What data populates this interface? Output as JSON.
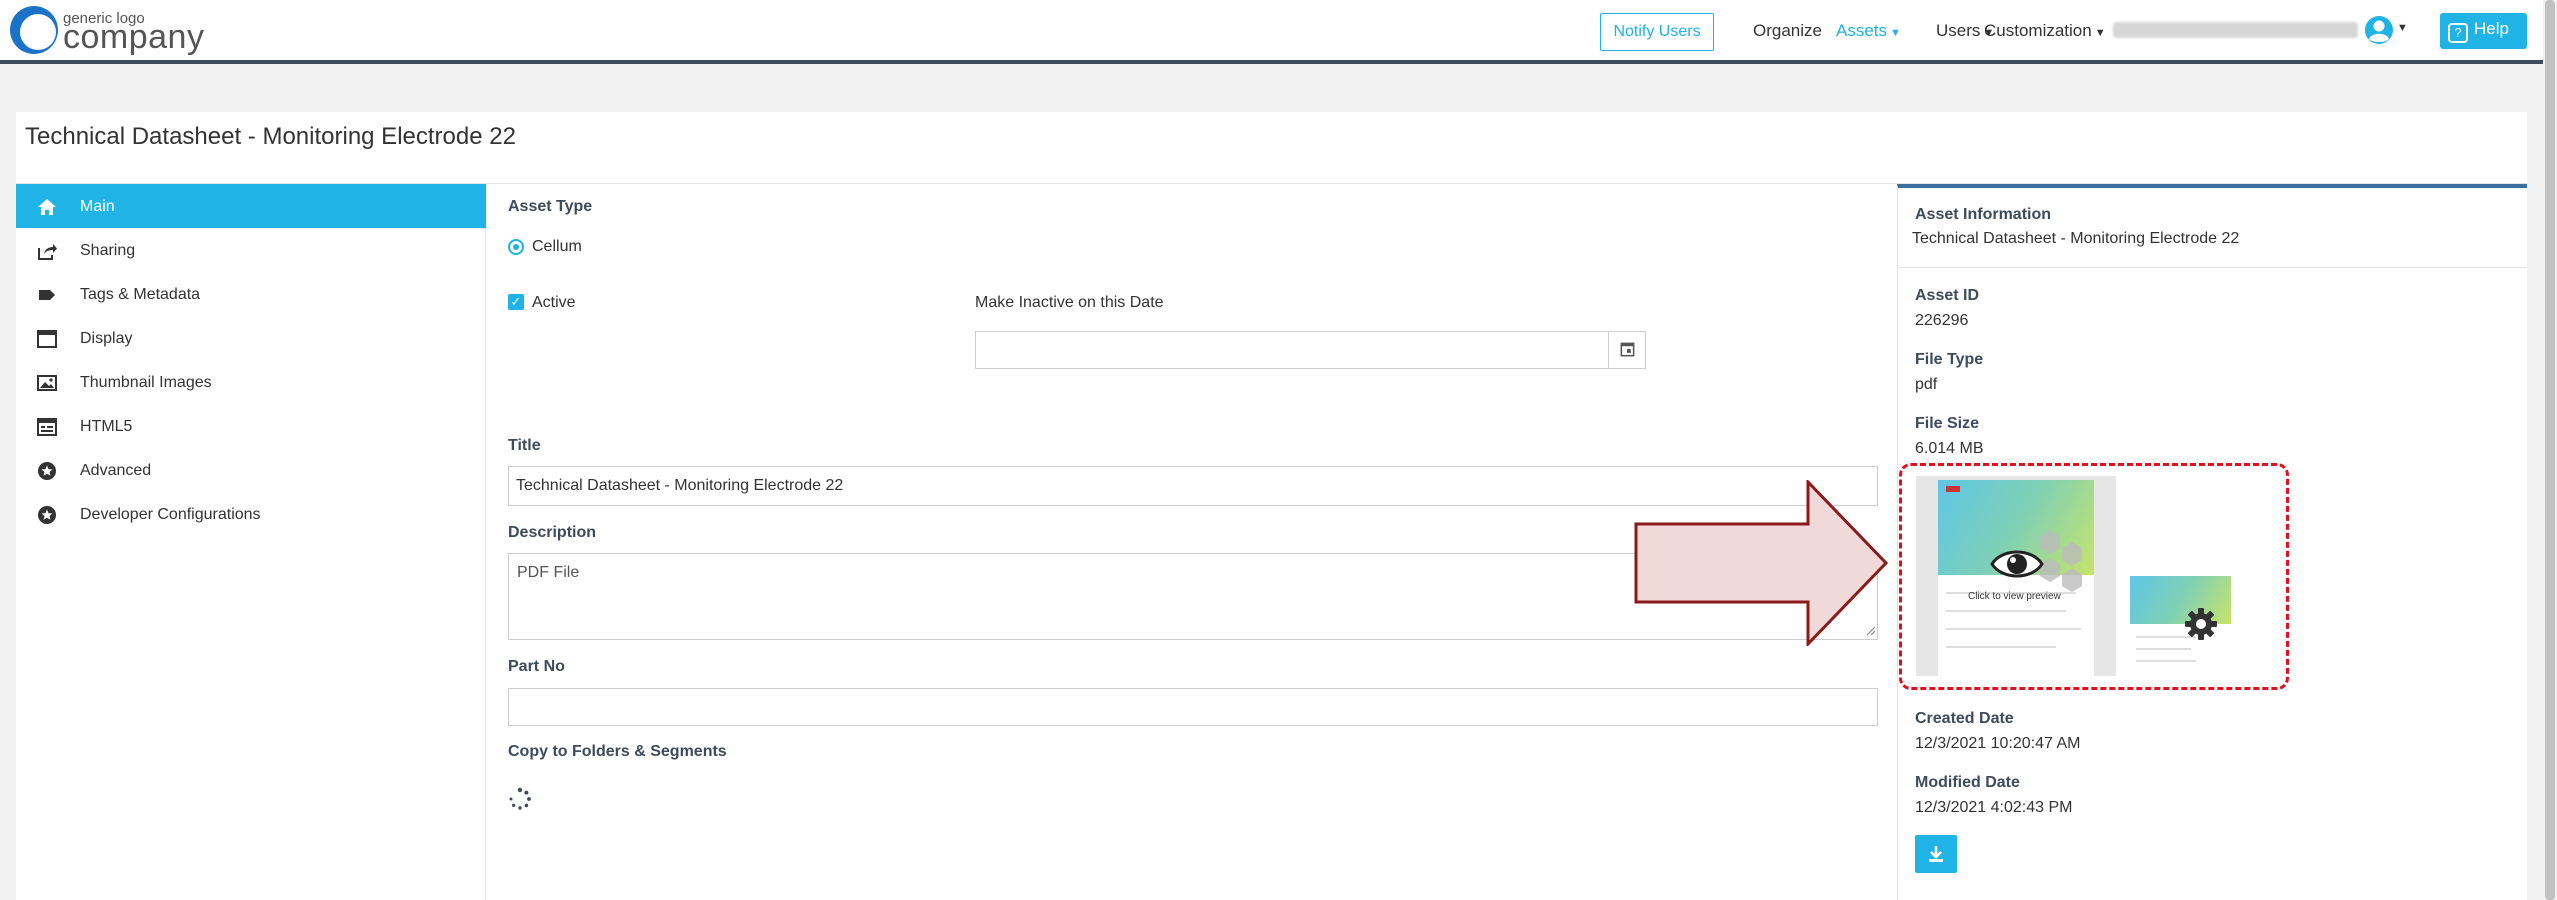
{
  "header": {
    "logo_top": "generic logo",
    "logo_bottom": "company",
    "notify_label": "Notify Users",
    "nav": [
      {
        "label": "Organize"
      },
      {
        "label": "Assets"
      },
      {
        "label": "Users"
      },
      {
        "label": "Customization"
      }
    ],
    "help_label": "Help",
    "accent_color": "#1fb3e6"
  },
  "page": {
    "title": "Technical Datasheet - Monitoring Electrode 22"
  },
  "sidebar": {
    "items": [
      {
        "label": "Main",
        "icon": "home-icon",
        "active": true
      },
      {
        "label": "Sharing",
        "icon": "share-icon"
      },
      {
        "label": "Tags & Metadata",
        "icon": "tag-icon"
      },
      {
        "label": "Display",
        "icon": "window-icon"
      },
      {
        "label": "Thumbnail Images",
        "icon": "image-icon"
      },
      {
        "label": "HTML5",
        "icon": "html5-icon"
      },
      {
        "label": "Advanced",
        "icon": "star-circle-icon"
      },
      {
        "label": "Developer Configurations",
        "icon": "star-circle-icon"
      }
    ]
  },
  "form": {
    "asset_type_label": "Asset Type",
    "asset_type_option": "Cellum",
    "active_label": "Active",
    "active_checked": true,
    "inactive_date_label": "Make Inactive on this Date",
    "inactive_date_value": "",
    "title_label": "Title",
    "title_value": "Technical Datasheet - Monitoring Electrode 22",
    "description_label": "Description",
    "description_value": "PDF File",
    "part_no_label": "Part No",
    "part_no_value": "",
    "copy_label": "Copy to Folders & Segments"
  },
  "info": {
    "heading": "Asset Information",
    "name": "Technical Datasheet - Monitoring Electrode 22",
    "asset_id_label": "Asset ID",
    "asset_id": "226296",
    "file_type_label": "File Type",
    "file_type": "pdf",
    "file_size_label": "File Size",
    "file_size": "6.014 MB",
    "preview_text": "Click to view preview",
    "created_label": "Created Date",
    "created": "12/3/2021 10:20:47 AM",
    "modified_label": "Modified Date",
    "modified": "12/3/2021 4:02:43 PM",
    "highlight_color": "#e0101c",
    "arrow_fill": "#f0d6d6",
    "arrow_stroke": "#8b1a1a"
  }
}
